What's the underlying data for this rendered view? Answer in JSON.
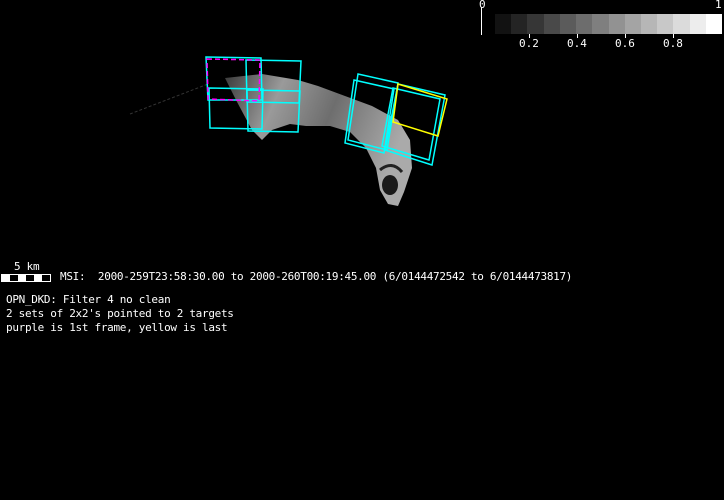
{
  "colorbar": {
    "min_label": "0",
    "max_label": "1",
    "tick_labels": [
      "0.2",
      "0.4",
      "0.6",
      "0.8"
    ],
    "steps": 14
  },
  "scale_bar": {
    "label": "5 km"
  },
  "header": {
    "line": "MSI:  2000-259T23:58:30.00 to 2000-260T00:19:45.00 (6/0144472542 to 6/0144473817)"
  },
  "notes": [
    "OPN_DKD: Filter 4 no clean",
    "2 sets of 2x2's pointed to 2 targets",
    "purple is 1st frame, yellow is last"
  ],
  "colors": {
    "frame": "#00ffff",
    "first_frame": "#ff00ff",
    "last_frame": "#ffff00"
  }
}
